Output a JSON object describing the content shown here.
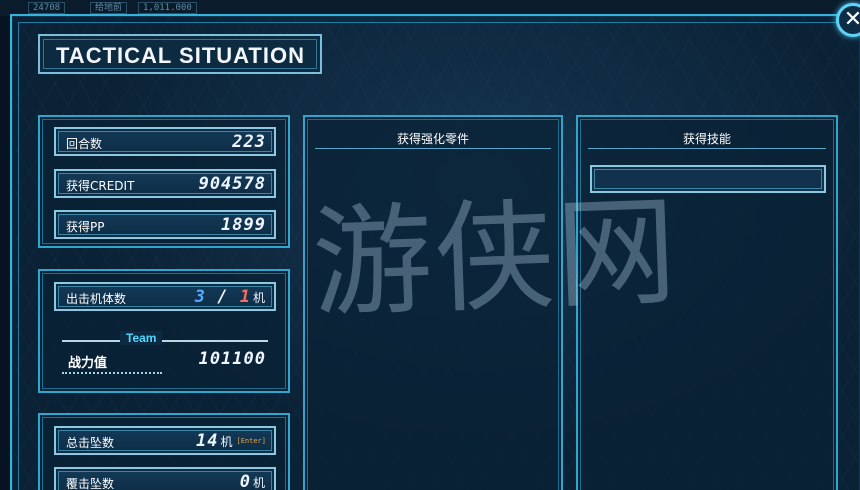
{
  "window": {
    "title": "TACTICAL SITUATION",
    "close_label": "✕",
    "top_strip": [
      "24708",
      "给地前",
      "1,011.000"
    ]
  },
  "stats": {
    "turns": {
      "label": "回合数",
      "value": "223"
    },
    "credit": {
      "label": "获得CREDIT",
      "value": "904578"
    },
    "pp": {
      "label": "获得PP",
      "value": "1899"
    }
  },
  "units": {
    "sortie": {
      "label": "出击机体数",
      "current": "3",
      "separator": "/",
      "lost": "1",
      "unit": "机"
    },
    "team": {
      "tag": "Team",
      "label": "战力值",
      "value": "101100"
    }
  },
  "kills": {
    "total": {
      "label": "总击坠数",
      "value": "14",
      "unit": "机",
      "hint": "[Enter]"
    },
    "destroyed": {
      "label": "覆击坠数",
      "value": "0",
      "unit": "机"
    }
  },
  "columns": {
    "parts_header": "获得强化零件",
    "skills_header": "获得技能"
  },
  "watermark": "游侠网",
  "colors": {
    "frame": "#35b3dc",
    "panel_bg": "#0b2236",
    "accent_blue": "#56a8ff",
    "accent_red": "#ff6a5a",
    "team_cyan": "#4fd8ff",
    "enter_orange": "#e9a24a"
  }
}
